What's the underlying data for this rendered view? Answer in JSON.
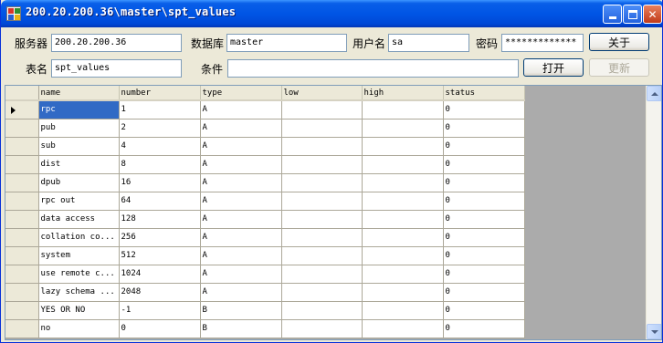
{
  "window": {
    "title": "200.20.200.36\\master\\spt_values",
    "min_icon": "minimize-icon",
    "max_icon": "maximize-icon",
    "close_icon": "close-icon"
  },
  "form": {
    "server_label": "服务器",
    "server_value": "200.20.200.36",
    "database_label": "数据库",
    "database_value": "master",
    "user_label": "用户名",
    "user_value": "sa",
    "password_label": "密码",
    "password_value": "*************",
    "about_label": "关于",
    "table_label": "表名",
    "table_value": "spt_values",
    "condition_label": "条件",
    "condition_value": "",
    "open_label": "打开",
    "update_label": "更新"
  },
  "grid": {
    "columns": [
      "name",
      "number",
      "type",
      "low",
      "high",
      "status"
    ],
    "rows": [
      [
        "rpc",
        "1",
        "A",
        "",
        "",
        "0"
      ],
      [
        "pub",
        "2",
        "A",
        "",
        "",
        "0"
      ],
      [
        "sub",
        "4",
        "A",
        "",
        "",
        "0"
      ],
      [
        "dist",
        "8",
        "A",
        "",
        "",
        "0"
      ],
      [
        "dpub",
        "16",
        "A",
        "",
        "",
        "0"
      ],
      [
        "rpc out",
        "64",
        "A",
        "",
        "",
        "0"
      ],
      [
        "data access",
        "128",
        "A",
        "",
        "",
        "0"
      ],
      [
        "collation co...",
        "256",
        "A",
        "",
        "",
        "0"
      ],
      [
        "system",
        "512",
        "A",
        "",
        "",
        "0"
      ],
      [
        "use remote c...",
        "1024",
        "A",
        "",
        "",
        "0"
      ],
      [
        "lazy schema ...",
        "2048",
        "A",
        "",
        "",
        "0"
      ],
      [
        "YES OR NO",
        "-1",
        "B",
        "",
        "",
        "0"
      ],
      [
        "no",
        "0",
        "B",
        "",
        "",
        "0"
      ]
    ]
  },
  "colors": {
    "title_bar": "#0055E5",
    "selection": "#316AC5",
    "grid_bg": "#ABABAB"
  }
}
